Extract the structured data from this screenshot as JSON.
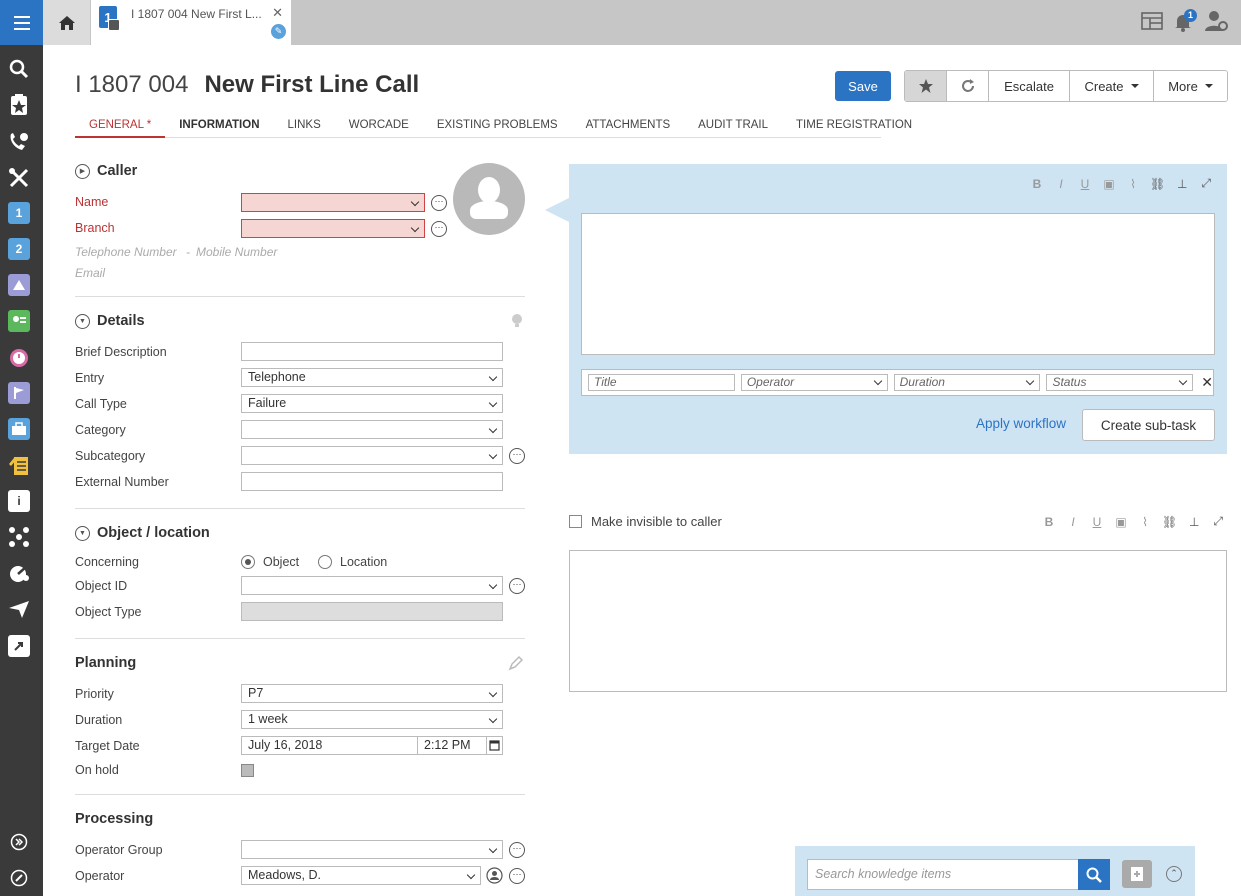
{
  "rail": {
    "icons": [
      "menu-icon",
      "search-icon",
      "favorites-icon",
      "calls-icon",
      "changes-icon",
      "first-line-icon",
      "second-line-icon",
      "problems-icon",
      "contacts-icon",
      "planning-icon",
      "projects-icon",
      "assets-icon",
      "knowledge-icon",
      "info-icon",
      "operations-icon",
      "reports-icon",
      "send-icon",
      "export-icon",
      "expand-icon",
      "edit-icon"
    ]
  },
  "topbar": {
    "tab_label": "I 1807 004 New First L...",
    "tab_badge": "1",
    "notifications_count": "1"
  },
  "header": {
    "number": "I 1807 004",
    "title": "New First Line Call",
    "save": "Save",
    "escalate": "Escalate",
    "create": "Create",
    "more": "More"
  },
  "tabs": [
    {
      "label": "GENERAL *"
    },
    {
      "label": "INFORMATION"
    },
    {
      "label": "LINKS"
    },
    {
      "label": "WORCADE"
    },
    {
      "label": "EXISTING PROBLEMS"
    },
    {
      "label": "ATTACHMENTS"
    },
    {
      "label": "AUDIT TRAIL"
    },
    {
      "label": "TIME REGISTRATION"
    }
  ],
  "caller": {
    "heading": "Caller",
    "name_label": "Name",
    "branch_label": "Branch",
    "telephone_hint": "Telephone Number",
    "separator": "-",
    "mobile_hint": "Mobile Number",
    "email_hint": "Email"
  },
  "details": {
    "heading": "Details",
    "brief_description_label": "Brief Description",
    "brief_description_value": "",
    "entry_label": "Entry",
    "entry_value": "Telephone",
    "call_type_label": "Call Type",
    "call_type_value": "Failure",
    "category_label": "Category",
    "category_value": "",
    "subcategory_label": "Subcategory",
    "subcategory_value": "",
    "external_number_label": "External Number",
    "external_number_value": ""
  },
  "object": {
    "heading": "Object / location",
    "concerning_label": "Concerning",
    "opt_object": "Object",
    "opt_location": "Location",
    "object_id_label": "Object ID",
    "object_type_label": "Object Type"
  },
  "planning": {
    "heading": "Planning",
    "priority_label": "Priority",
    "priority_value": "P7",
    "duration_label": "Duration",
    "duration_value": "1 week",
    "target_date_label": "Target Date",
    "target_date_value": "July 16, 2018",
    "target_time_value": "2:12 PM",
    "on_hold_label": "On hold"
  },
  "processing": {
    "heading": "Processing",
    "operator_group_label": "Operator Group",
    "operator_group_value": "",
    "operator_label": "Operator",
    "operator_value": "Meadows, D."
  },
  "request_panel": {
    "toolbar": [
      "B",
      "I",
      "U"
    ],
    "task_title_placeholder": "Title",
    "task_operator_placeholder": "Operator",
    "task_duration_placeholder": "Duration",
    "task_status_placeholder": "Status",
    "apply_workflow": "Apply workflow",
    "create_subtask": "Create sub-task"
  },
  "action_panel": {
    "invisible_label": "Make invisible to caller",
    "toolbar": [
      "B",
      "I",
      "U"
    ]
  },
  "knowledge": {
    "search_placeholder": "Search knowledge items"
  },
  "colors": {
    "accent": "#2b74c4",
    "error": "#b33333",
    "panel": "#cfe4f3",
    "rail": "#3a3a3a"
  }
}
